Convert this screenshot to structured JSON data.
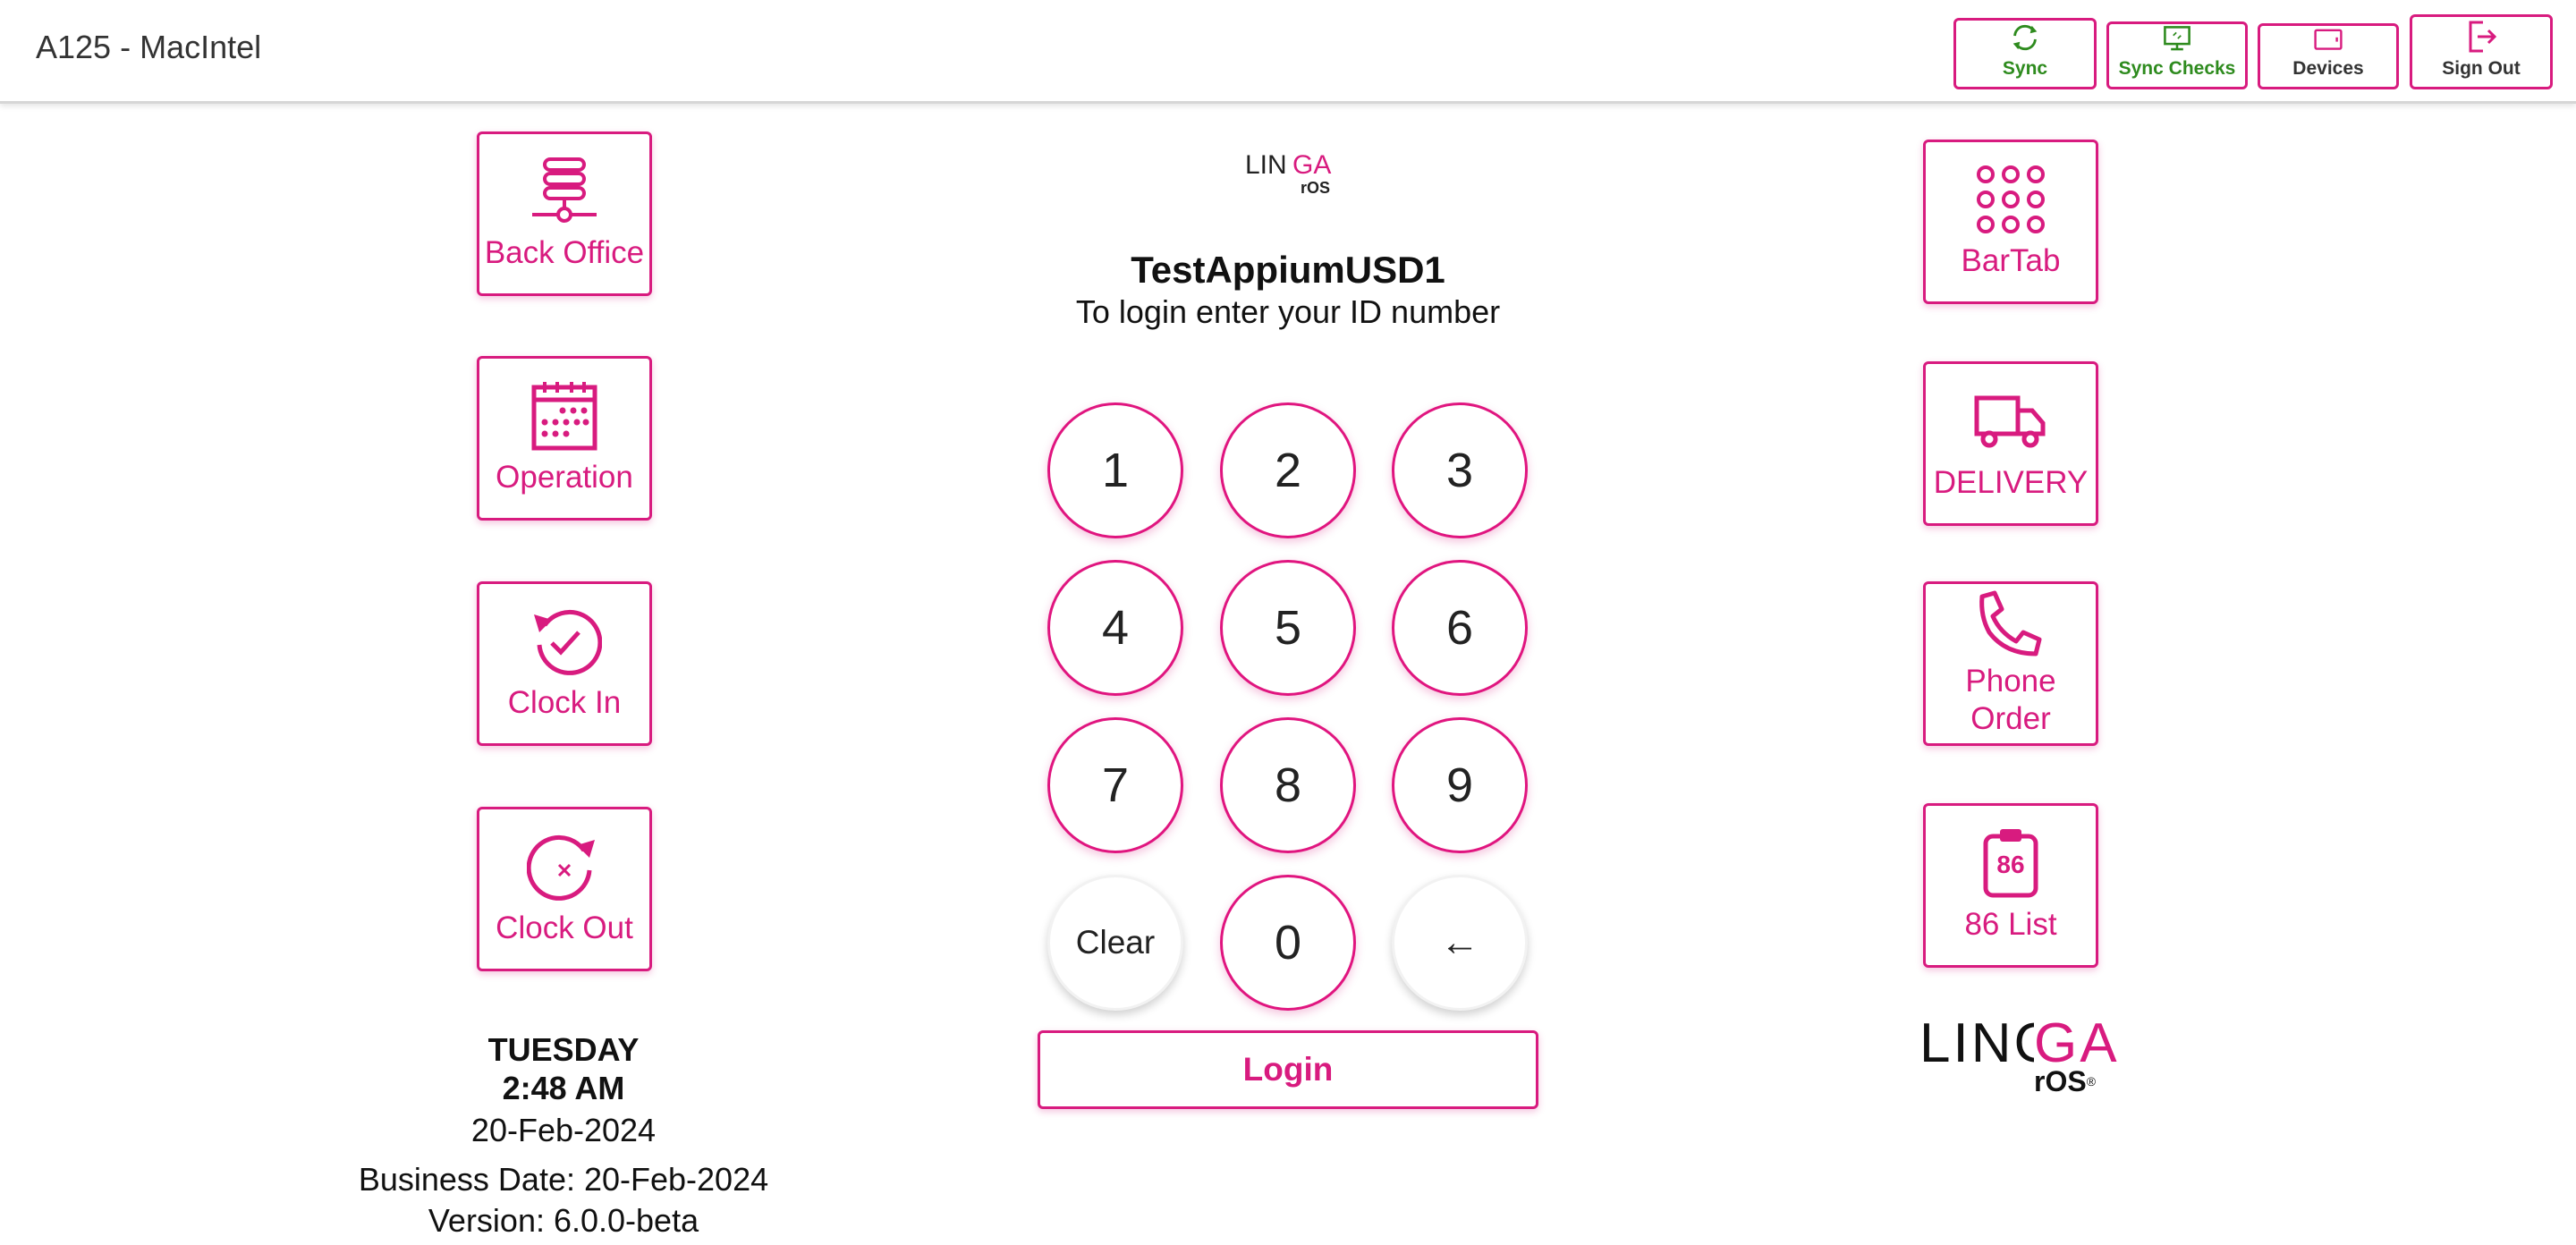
{
  "header": {
    "device_name": "A125 - MacIntel",
    "buttons": {
      "sync": "Sync",
      "sync_checks": "Sync Checks",
      "devices": "Devices",
      "sign_out": "Sign Out"
    }
  },
  "left_tiles": {
    "back_office": "Back Office",
    "operation": "Operation",
    "clock_in": "Clock In",
    "clock_out": "Clock Out"
  },
  "right_tiles": {
    "bartab": "BarTab",
    "delivery": "DELIVERY",
    "phone_order_line1": "Phone",
    "phone_order_line2": "Order",
    "list86": "86 List",
    "list86_badge": "86"
  },
  "login": {
    "store_name": "TestAppiumUSD1",
    "hint": "To login enter your ID number",
    "keys": [
      "1",
      "2",
      "3",
      "4",
      "5",
      "6",
      "7",
      "8",
      "9",
      "Clear",
      "0",
      "←"
    ],
    "login_label": "Login"
  },
  "logo": {
    "brand_main": "LINGA",
    "brand_sub": "rOS",
    "registered": "®"
  },
  "info": {
    "day": "TUESDAY",
    "time": "2:48 AM",
    "date": "20-Feb-2024",
    "business_date": "Business Date: 20-Feb-2024",
    "version": "Version: 6.0.0-beta"
  },
  "colors": {
    "brand_pink": "#d81b7f",
    "sync_green": "#2e8b1e",
    "text_dark": "#222222"
  },
  "icons": {
    "sync": "sync-icon",
    "sync_checks": "monitor-sync-icon",
    "devices": "tablet-icon",
    "sign_out": "sign-out-icon",
    "back_office": "server-icon",
    "operation": "calendar-icon",
    "clock_in": "clock-check-icon",
    "clock_out": "clock-x-icon",
    "bartab": "grid-dots-icon",
    "delivery": "truck-icon",
    "phone_order": "phone-icon",
    "list86": "clipboard-icon"
  }
}
